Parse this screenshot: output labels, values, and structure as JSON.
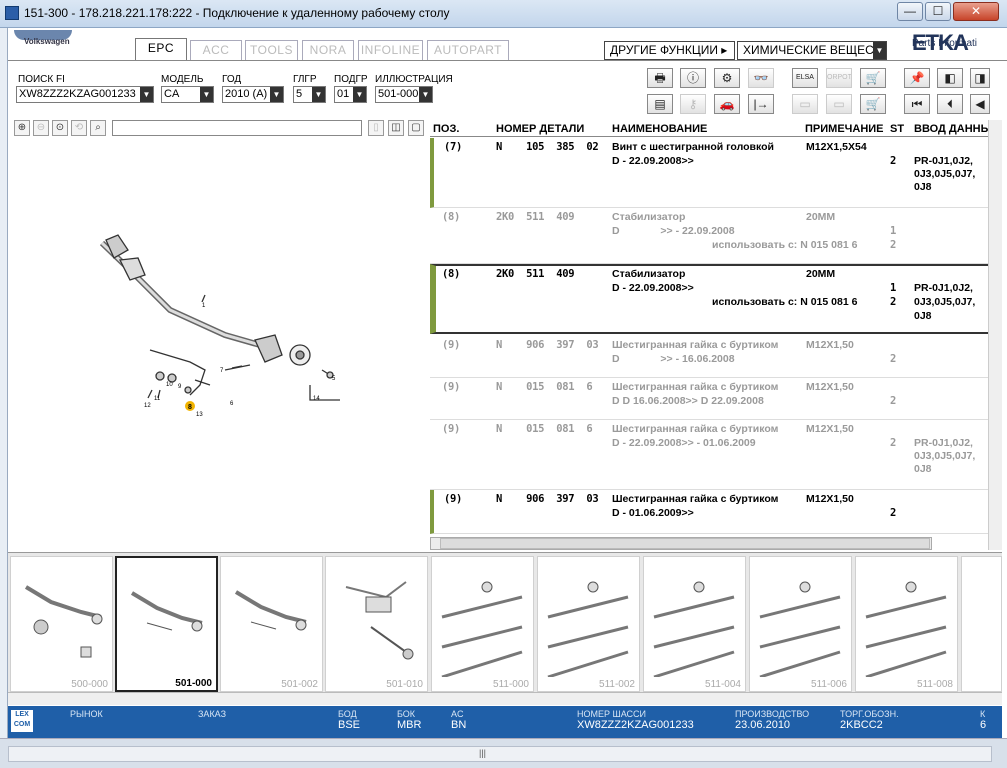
{
  "window": {
    "title": "151-300 - 178.218.221.178:222 - Подключение к удаленному рабочему столу",
    "min": "—",
    "max": "☐",
    "close": "✕"
  },
  "brand": {
    "logo_text": "Volkswagen",
    "name": "ETKA",
    "sub": "Parts Informati"
  },
  "tabs": [
    {
      "label": "EPC",
      "active": true
    },
    {
      "label": "ACC"
    },
    {
      "label": "TOOLS"
    },
    {
      "label": "NORA"
    },
    {
      "label": "INFOLINE"
    },
    {
      "label": "AUTOPART"
    }
  ],
  "functions": {
    "other_label": "ДРУГИЕ ФУНКЦИИ ▸",
    "chem_label": "ХИМИЧЕСКИЕ ВЕЩЕСТ"
  },
  "filters": {
    "vin": {
      "label": "ПОИСК FI",
      "value": "XW8ZZZ2KZAG001233"
    },
    "model": {
      "label": "МОДЕЛЬ",
      "value": "CA"
    },
    "year": {
      "label": "ГОД",
      "value": "2010 (A)"
    },
    "maingroup": {
      "label": "ГЛГР",
      "value": "5"
    },
    "subgroup": {
      "label": "ПОДГР",
      "value": "01"
    },
    "illustration": {
      "label": "ИЛЛЮСТРАЦИЯ",
      "value": "501-000"
    }
  },
  "toolbar_icons": {
    "row1": [
      "print-icon",
      "info-icon",
      "service-icon",
      "glasses-icon",
      "elsa-icon",
      "orpot-icon",
      "cart-arrow-icon",
      "pin-icon",
      "prev-page-icon",
      "next-page-icon"
    ],
    "row2": [
      "list-icon",
      "key-icon",
      "car-icon",
      "minus-arrow-icon",
      "doc-icon",
      "doc2-icon",
      "cart-icon",
      "first-icon",
      "prev-icon",
      "back-icon"
    ],
    "row1_labels": [
      "🖶",
      "ⓘ",
      "⚙",
      "👓",
      "ELSA",
      "ORPOT",
      "🛒",
      "📌",
      "◧",
      "◨"
    ],
    "row2_labels": [
      "▤",
      "⚷",
      "🚗",
      "|→",
      "▭",
      "▭",
      "🛒",
      "⏮",
      "⏴",
      "◀"
    ]
  },
  "table": {
    "headers": [
      "ПОЗ.",
      "НОМЕР ДЕТАЛИ",
      "НАИМЕНОВАНИЕ",
      "ПРИМЕЧАНИЕ",
      "ST",
      "ВВОД ДАННЫХ"
    ],
    "rows": [
      {
        "pos": "(7)",
        "part": "N    105  385  02",
        "name": "Винт с шестигранной головкой",
        "note": "M12X1,5X54",
        "l2": "D - 22.09.2008>>",
        "st": "2",
        "data": [
          "PR-0J1,0J2,",
          "0J3,0J5,0J7,",
          "0J8"
        ],
        "state": "mark"
      },
      {
        "pos": "(8)",
        "part": "2K0  511  409",
        "name": "Стабилизатор",
        "note": "20MM",
        "l2": "D              >> - 22.09.2008",
        "l3": "использовать с:  N   015 081 6",
        "st": "1",
        "st2": "2",
        "state": "grey"
      },
      {
        "pos": "(8)",
        "part": "2K0  511  409",
        "name": "Стабилизатор",
        "note": "20MM",
        "l2": "D - 22.09.2008>>",
        "l3": "использовать с:  N   015 081 6",
        "st": "1",
        "st2": "2",
        "data": [
          "PR-0J1,0J2,",
          "0J3,0J5,0J7,",
          "0J8"
        ],
        "state": "sel"
      },
      {
        "pos": "(9)",
        "part": "N    906  397  03",
        "name": "Шестигранная гайка с буртиком",
        "note": "M12X1,50",
        "l2": "D              >> - 16.06.2008",
        "st": "2",
        "state": "grey"
      },
      {
        "pos": "(9)",
        "part": "N    015  081  6",
        "name": "Шестигранная гайка с буртиком",
        "note": "M12X1,50",
        "l2": "D D 16.06.2008>> D 22.09.2008",
        "st": "2",
        "state": "grey"
      },
      {
        "pos": "(9)",
        "part": "N    015  081  6",
        "name": "Шестигранная гайка с буртиком",
        "note": "M12X1,50",
        "l2": "D - 22.09.2008>> - 01.06.2009",
        "st": "2",
        "data": [
          "PR-0J1,0J2,",
          "0J3,0J5,0J7,",
          "0J8"
        ],
        "state": "grey"
      },
      {
        "pos": "(9)",
        "part": "N    906  397  03",
        "name": "Шестигранная гайка с буртиком",
        "note": "M12X1,50",
        "l2": "D - 01.06.2009>>",
        "st": "2",
        "state": "mark"
      }
    ]
  },
  "illustration_callouts": [
    "1",
    "7",
    "8",
    "9",
    "10",
    "11",
    "12",
    "13",
    "14",
    "5",
    "6"
  ],
  "thumbnails": [
    {
      "label": "500-000"
    },
    {
      "label": "501-000",
      "current": true
    },
    {
      "label": "501-002"
    },
    {
      "label": "501-010"
    },
    {
      "label": "511-000",
      "bold": true
    },
    {
      "label": "511-002"
    },
    {
      "label": "511-004"
    },
    {
      "label": "511-006"
    },
    {
      "label": "511-008"
    }
  ],
  "status": {
    "lexcom": "LEX COM",
    "market_label": "РЫНОК",
    "order_label": "ЗАКАЗ",
    "bod_label": "БОД",
    "bod": "BSE",
    "bok_label": "БОК",
    "bok": "MBR",
    "ac_label": "AC",
    "ac": "BN",
    "chassis_label": "НОМЕР ШАССИ",
    "chassis": "XW8ZZZ2KZAG001233",
    "production_label": "ПРОИЗВОДСТВО",
    "production": "23.06.2010",
    "trade_label": "ТОРГ.ОБОЗН.",
    "trade": "2KBCC2",
    "k_label": "К",
    "k": "6"
  },
  "scroll": {
    "grip": "|||"
  }
}
